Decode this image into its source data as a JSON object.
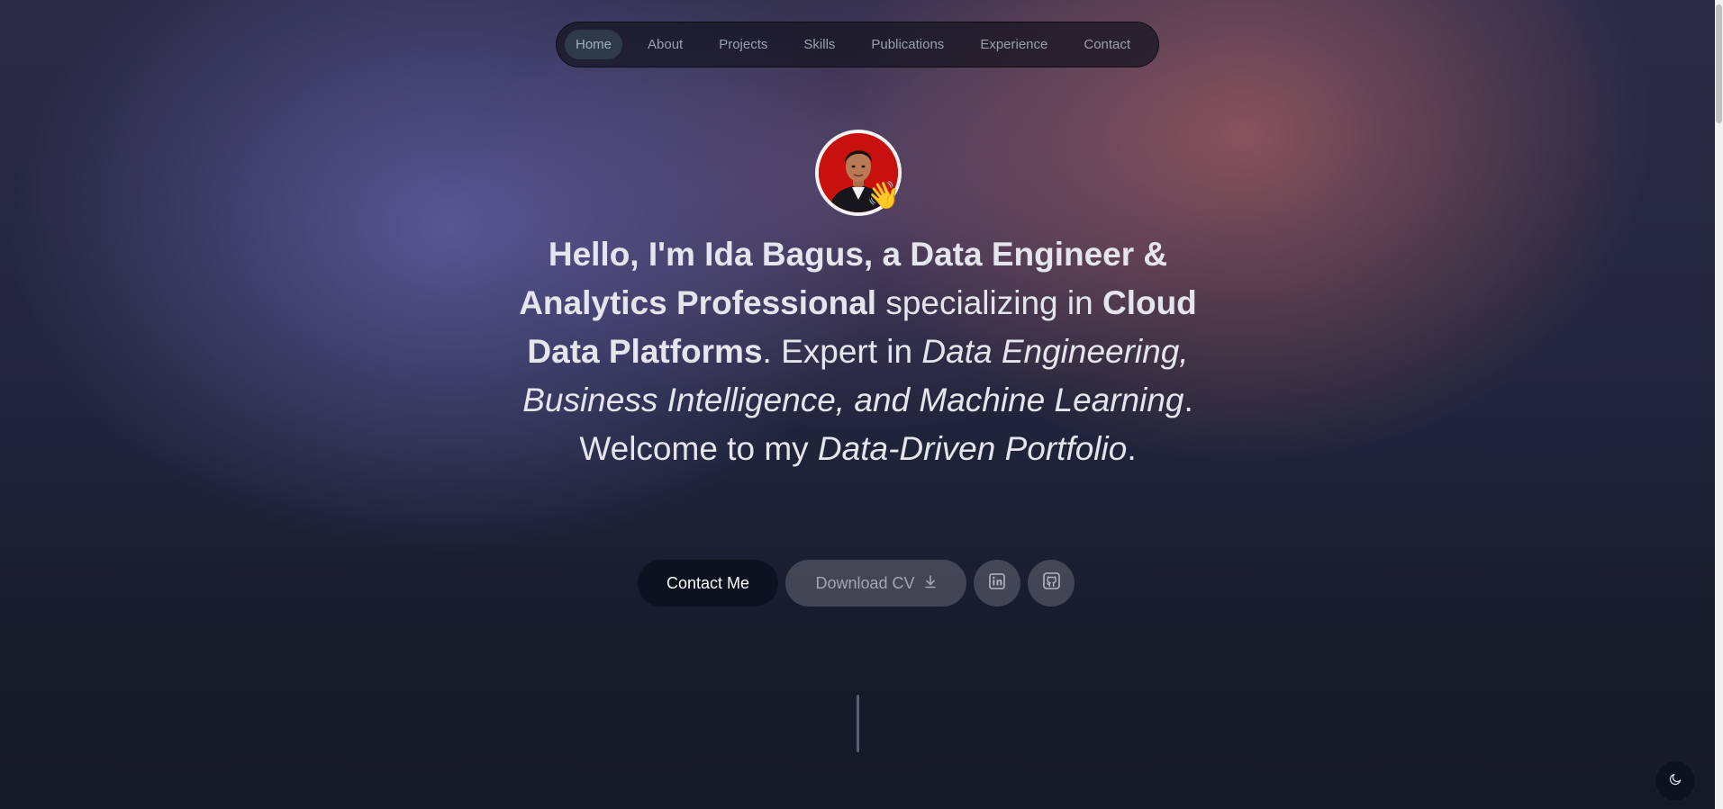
{
  "nav": {
    "items": [
      {
        "label": "Home",
        "active": true
      },
      {
        "label": "About"
      },
      {
        "label": "Projects"
      },
      {
        "label": "Skills"
      },
      {
        "label": "Publications"
      },
      {
        "label": "Experience"
      },
      {
        "label": "Contact"
      }
    ]
  },
  "hero": {
    "avatar_icon": "waving-hand",
    "wave_emoji": "👋",
    "headline": {
      "p1": "Hello, I'm Ida Bagus, a Data Engineer & Analytics Professional",
      "p2": " specializing in ",
      "p3": "Cloud Data Platforms",
      "p4": ". Expert in ",
      "p5": "Data Engineering, Business Intelligence, and Machine Learning",
      "p6": ". Welcome to my ",
      "p7": "Data-Driven Portfolio",
      "p8": "."
    },
    "contact_label": "Contact Me",
    "download_label": "Download CV",
    "linkedin_icon": "linkedin-icon",
    "github_icon": "github-icon"
  },
  "theme_toggle_icon": "moon-icon",
  "colors": {
    "accent_dark": "#0d1220",
    "text": "#e5e5ee",
    "muted": "#9aa0ad",
    "avatar_bg": "#c8100e"
  }
}
